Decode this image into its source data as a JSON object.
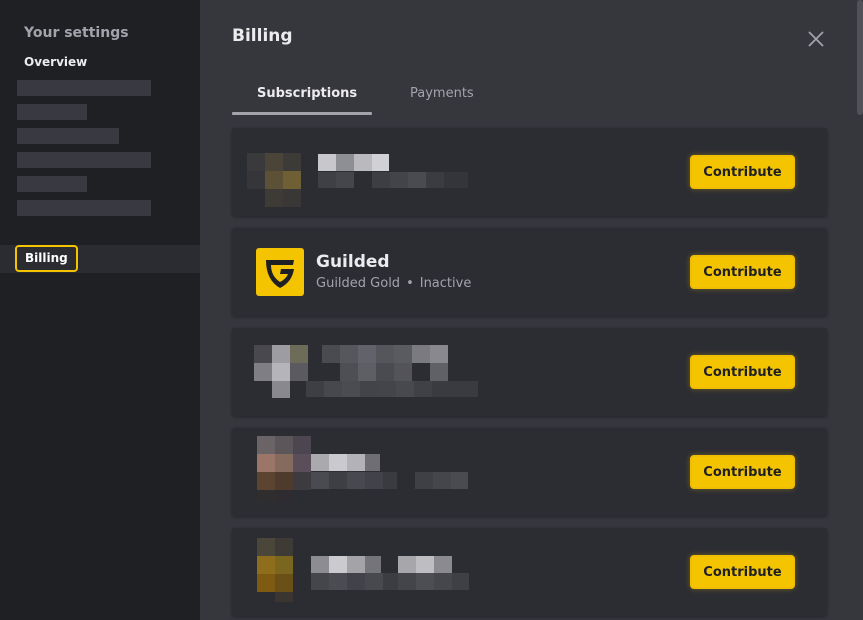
{
  "sidebar": {
    "heading": "Your settings",
    "overview": "Overview",
    "billing": "Billing"
  },
  "main": {
    "title": "Billing",
    "tabs": [
      {
        "label": "Subscriptions",
        "active": true
      },
      {
        "label": "Payments",
        "active": false
      }
    ],
    "subscriptions": [
      {
        "name": "",
        "plan": "",
        "status": "",
        "button": "Contribute"
      },
      {
        "name": "Guilded",
        "plan": "Guilded Gold",
        "status": "Inactive",
        "button": "Contribute"
      },
      {
        "name": "",
        "plan": "",
        "status": "",
        "button": "Contribute"
      },
      {
        "name": "",
        "plan": "",
        "status": "",
        "button": "Contribute"
      },
      {
        "name": "",
        "plan": "",
        "status": "",
        "button": "Contribute"
      }
    ]
  },
  "colors": {
    "accent": "#f5c400",
    "sidebar_bg": "#1f2024",
    "main_bg": "#36363d",
    "card_bg": "#2c2d33"
  },
  "icons": {
    "close": "close-icon",
    "guilded_logo": "guilded-logo-icon"
  }
}
